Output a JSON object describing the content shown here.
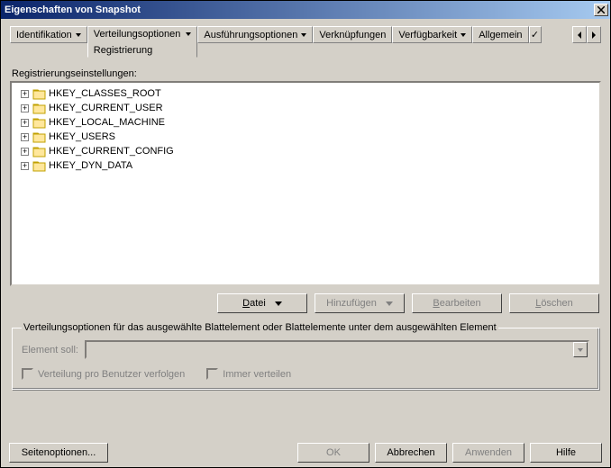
{
  "title": "Eigenschaften von Snapshot",
  "tabs": {
    "identifikation": "Identifikation",
    "verteilung": "Verteilungsoptionen",
    "verteilung_sub": "Registrierung",
    "ausfuehrung": "Ausführungsoptionen",
    "verknuepfungen": "Verknüpfungen",
    "verfuegbarkeit": "Verfügbarkeit",
    "allgemein": "Allgemein"
  },
  "section_label": "Registrierungseinstellungen:",
  "tree": [
    "HKEY_CLASSES_ROOT",
    "HKEY_CURRENT_USER",
    "HKEY_LOCAL_MACHINE",
    "HKEY_USERS",
    "HKEY_CURRENT_CONFIG",
    "HKEY_DYN_DATA"
  ],
  "buttons": {
    "datei": "Datei",
    "hinzufuegen": "Hinzufügen",
    "bearbeiten": "Bearbeiten",
    "loeschen": "Löschen"
  },
  "group": {
    "legend": "Verteilungsoptionen für das ausgewählte Blattelement oder Blattelemente unter dem ausgewählten Element",
    "element_label": "Element soll:",
    "chk1": "Verteilung pro Benutzer verfolgen",
    "chk2": "Immer verteilen"
  },
  "footer": {
    "page_options": "Seitenoptionen...",
    "ok": "OK",
    "abbrechen": "Abbrechen",
    "anwenden": "Anwenden",
    "hilfe": "Hilfe"
  }
}
